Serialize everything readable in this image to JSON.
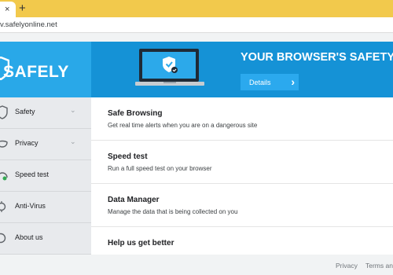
{
  "browser": {
    "tab_close": "×",
    "new_tab": "+",
    "url": "v.safelyonline.net"
  },
  "header": {
    "logo_text": "SAFELY",
    "banner_title": "YOUR BROWSER'S SAFETY",
    "details_label": "Details",
    "brand_color": "#29a8e8",
    "banner_color": "#1592d6"
  },
  "sidebar": {
    "items": [
      {
        "label": "Safety",
        "icon": "shield-icon",
        "caret": "⌄"
      },
      {
        "label": "Privacy",
        "icon": "mask-icon",
        "caret": "⌄"
      },
      {
        "label": "Speed test",
        "icon": "speedometer-icon",
        "caret": ""
      },
      {
        "label": "Anti-Virus",
        "icon": "virus-icon",
        "caret": ""
      },
      {
        "label": "About us",
        "icon": "info-icon",
        "caret": ""
      }
    ]
  },
  "main": {
    "rows": [
      {
        "title": "Safe Browsing",
        "desc": "Get real time alerts when you are on a dangerous site"
      },
      {
        "title": "Speed test",
        "desc": "Run a full speed test on your browser"
      },
      {
        "title": "Data Manager",
        "desc": "Manage the data that is being collected on you"
      },
      {
        "title": "Help us get better",
        "desc": ""
      }
    ]
  },
  "footer": {
    "privacy": "Privacy",
    "terms": "Terms and"
  }
}
